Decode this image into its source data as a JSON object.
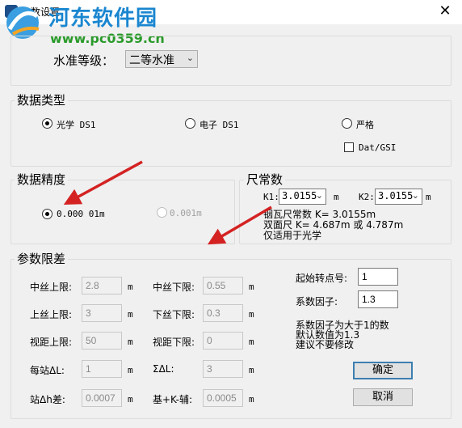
{
  "window": {
    "title": "参数设置",
    "close_glyph": "✕"
  },
  "watermark": {
    "name": "河东软件园",
    "url": "www.pc0359.cn"
  },
  "level": {
    "label": "水准等级：",
    "value": "二等水准",
    "arrow": "⌄"
  },
  "data_type": {
    "title": "数据类型",
    "options": [
      {
        "label": "光学 DS1",
        "checked": true
      },
      {
        "label": "电子 DS1",
        "checked": false
      },
      {
        "label": "严格",
        "checked": false
      }
    ],
    "checkbox_label": "Dat/GSI"
  },
  "precision": {
    "title": "数据精度",
    "options": [
      {
        "label": "0.000 01m",
        "checked": true
      },
      {
        "label": "0.001m",
        "checked": false
      }
    ]
  },
  "staff": {
    "title": "尺常数",
    "k1_label": "K1:",
    "k1_value": "3.0155",
    "k1_unit": "m",
    "k2_label": "K2:",
    "k2_value": "3.0155",
    "k2_unit": "m",
    "line1": "铟瓦尺常数 K= 3.0155m",
    "line2": "双面尺 K= 4.687m 或 4.787m",
    "line3": "仅适用于光学"
  },
  "limits": {
    "title": "参数限差",
    "rows": [
      {
        "left_label": "中丝上限:",
        "left_value": "2.8",
        "left_unit": "m",
        "right_label": "中丝下限:",
        "right_value": "0.55",
        "right_unit": "m"
      },
      {
        "left_label": "上丝上限:",
        "left_value": "3",
        "left_unit": "m",
        "right_label": "下丝下限:",
        "right_value": "0.3",
        "right_unit": "m"
      },
      {
        "left_label": "视距上限:",
        "left_value": "50",
        "left_unit": "m",
        "right_label": "视距下限:",
        "right_value": "0",
        "right_unit": "m"
      },
      {
        "left_label": "每站ΔL:",
        "left_value": "1",
        "left_unit": "m",
        "right_label": "ΣΔL:",
        "right_value": "3",
        "right_unit": "m"
      },
      {
        "left_label": "站Δh差:",
        "left_value": "0.0007",
        "left_unit": "m",
        "right_label": "基+K-辅:",
        "right_value": "0.0005",
        "right_unit": "m"
      }
    ],
    "start_label": "起始转点号:",
    "start_value": "1",
    "factor_label": "系数因子:",
    "factor_value": "1.3",
    "note1": "系数因子为大于1的数",
    "note2": "默认数值为1.3",
    "note3": "建议不要修改",
    "ok_label": "确定",
    "cancel_label": "取消"
  },
  "colors": {
    "arrow": "#d42222",
    "button_border": "#3c7fb1"
  }
}
